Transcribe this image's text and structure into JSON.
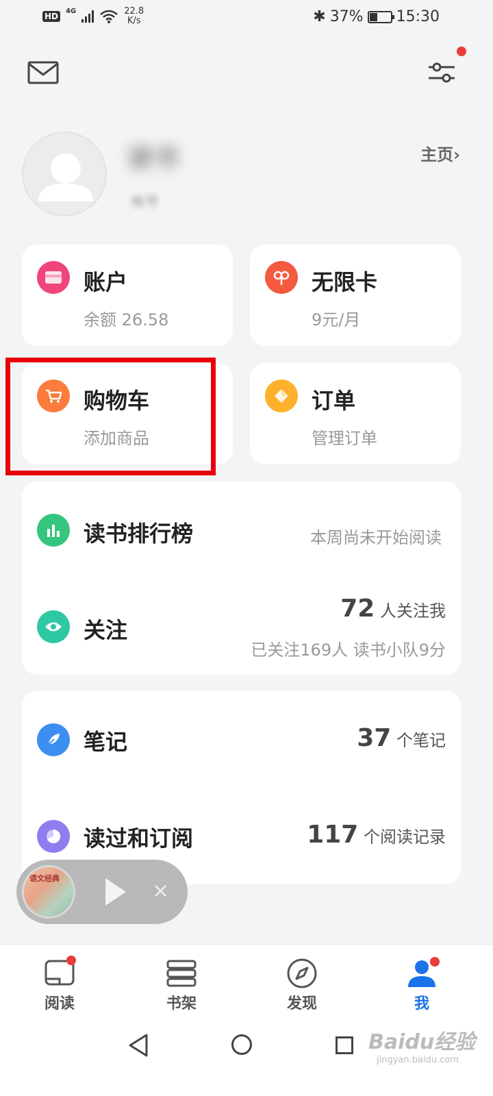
{
  "status_bar": {
    "hd": "HD",
    "network": "4G",
    "speed_value": "22.8",
    "speed_unit": "K/s",
    "battery": "37%",
    "battery_level": 0.37,
    "time": "15:30"
  },
  "header": {
    "mail_icon": "mail-icon",
    "settings_icon": "settings-icon",
    "notification_color": "#ec3b3b"
  },
  "profile": {
    "username": "读书",
    "subtitle": "帐号",
    "homepage": "主页",
    "homepage_arrow": "›"
  },
  "cards": {
    "account": {
      "title": "账户",
      "sub": "余额 26.58",
      "icon": "wallet-icon",
      "color": "#f0457a"
    },
    "unlimited": {
      "title": "无限卡",
      "sub": "9元/月",
      "icon": "infinity-card-icon",
      "color": "#f35a40"
    },
    "cart": {
      "title": "购物车",
      "sub": "添加商品",
      "icon": "cart-icon",
      "color": "#fb7c3c"
    },
    "orders": {
      "title": "订单",
      "sub": "管理订单",
      "icon": "order-icon",
      "color": "#fdb12a"
    }
  },
  "social": {
    "ranking": {
      "title": "读书排行榜",
      "right": "本周尚未开始阅读",
      "icon": "bar-chart-icon",
      "color": "#35c57f"
    },
    "follow": {
      "title": "关注",
      "count": "72",
      "count_label": "人关注我",
      "detail": "已关注169人 读书小队9分",
      "icon": "eye-icon",
      "color": "#2ec9a3"
    }
  },
  "records": {
    "notes": {
      "title": "笔记",
      "count": "37",
      "count_label": "个笔记",
      "icon": "feather-icon",
      "color": "#3c8ff0"
    },
    "reads": {
      "title": "读过和订阅",
      "count": "117",
      "count_label": "个阅读记录",
      "icon": "pie-icon",
      "color": "#8f7df0"
    }
  },
  "player": {
    "cover_text": "语文经典",
    "play_icon": "play-icon",
    "close": "×"
  },
  "tabs": [
    {
      "label": "阅读",
      "icon": "book-icon",
      "badge": true
    },
    {
      "label": "书架",
      "icon": "bookshelf-icon",
      "badge": false
    },
    {
      "label": "发现",
      "icon": "compass-icon",
      "badge": false
    },
    {
      "label": "我",
      "icon": "person-icon",
      "badge": true,
      "active": true
    }
  ],
  "accent_color": "#1a73e8",
  "watermark": {
    "brand": "Baidu经验",
    "url": "jingyan.baidu.com"
  }
}
